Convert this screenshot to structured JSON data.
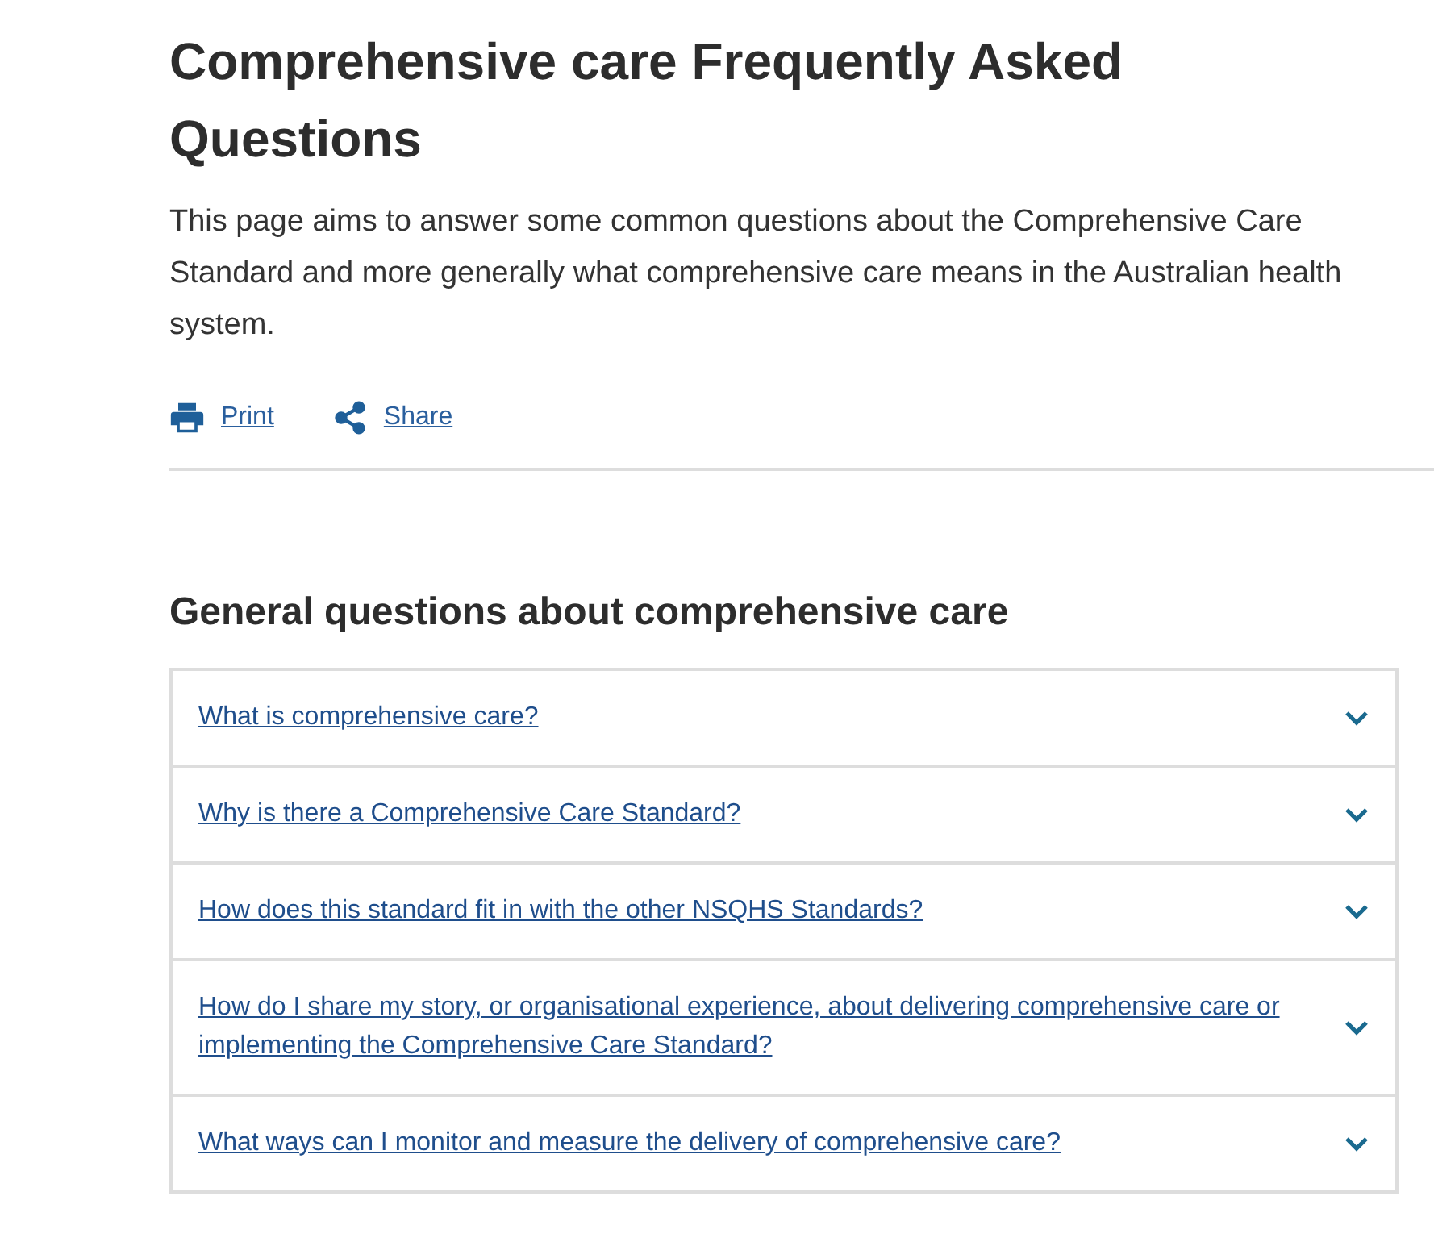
{
  "title": "Comprehensive care Frequently Asked Questions",
  "intro": "This page aims to answer some common questions about the Comprehensive Care Standard and more generally what comprehensive care means in the Australian health system.",
  "actions": [
    {
      "kind": "print",
      "label": "Print"
    },
    {
      "kind": "share",
      "label": "Share"
    }
  ],
  "section": {
    "heading": "General questions about comprehensive care",
    "questions": [
      {
        "text": "What is comprehensive care?",
        "expanded": false
      },
      {
        "text": "Why is there a Comprehensive Care Standard?",
        "expanded": false
      },
      {
        "text": "How does this standard fit in with the other NSQHS Standards?",
        "expanded": false
      },
      {
        "text": "How do I share my story, or organisational experience, about delivering comprehensive care or implementing the Comprehensive Care Standard?",
        "expanded": false
      },
      {
        "text": "What ways can I monitor and measure the delivery of comprehensive care?",
        "expanded": false
      }
    ]
  }
}
